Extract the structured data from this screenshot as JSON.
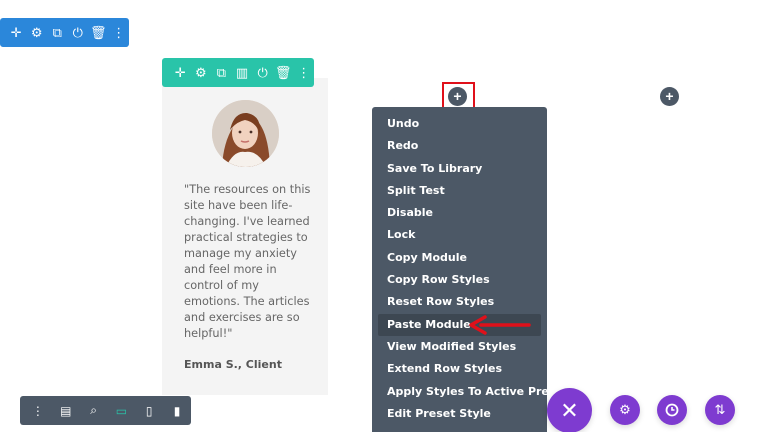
{
  "section_toolbar": {
    "icons": [
      "move-icon",
      "gear-icon",
      "duplicate-icon",
      "power-icon",
      "trash-icon",
      "more-icon"
    ],
    "color": "#2b87da"
  },
  "row_toolbar": {
    "icons": [
      "move-icon",
      "gear-icon",
      "duplicate-icon",
      "columns-icon",
      "power-icon",
      "trash-icon",
      "more-icon"
    ],
    "color": "#29c4a9"
  },
  "testimonial": {
    "quote": "\"The resources on this site have been life-changing. I've learned practical strategies to manage my anxiety and feel more in control of my emotions. The articles and exercises are so helpful!\"",
    "author": "Emma S., Client"
  },
  "add_buttons": {
    "symbol": "+"
  },
  "context_menu": {
    "items": [
      {
        "label": "Undo"
      },
      {
        "label": "Redo"
      },
      {
        "label": "Save To Library"
      },
      {
        "label": "Split Test"
      },
      {
        "label": "Disable"
      },
      {
        "label": "Lock"
      },
      {
        "label": "Copy Module"
      },
      {
        "label": "Copy Row Styles"
      },
      {
        "label": "Reset Row Styles"
      },
      {
        "label": "Paste Module"
      },
      {
        "label": "View Modified Styles"
      },
      {
        "label": "Extend Row Styles"
      },
      {
        "label": "Apply Styles To Active Preset"
      },
      {
        "label": "Edit Preset Style"
      }
    ],
    "highlighted": "Paste Module",
    "bg": "#4c5866"
  },
  "bottom_bar": {
    "icons": [
      "more-icon",
      "layers-icon",
      "zoom-icon",
      "desktop-icon",
      "tablet-icon",
      "phone-icon"
    ],
    "active": "desktop-icon"
  },
  "fabs": {
    "close_symbol": "✕",
    "icons": [
      "gear-icon",
      "history-icon",
      "sort-icon"
    ],
    "color": "#7e3bd0"
  },
  "annotations": {
    "highlight_color": "#e0101a"
  }
}
